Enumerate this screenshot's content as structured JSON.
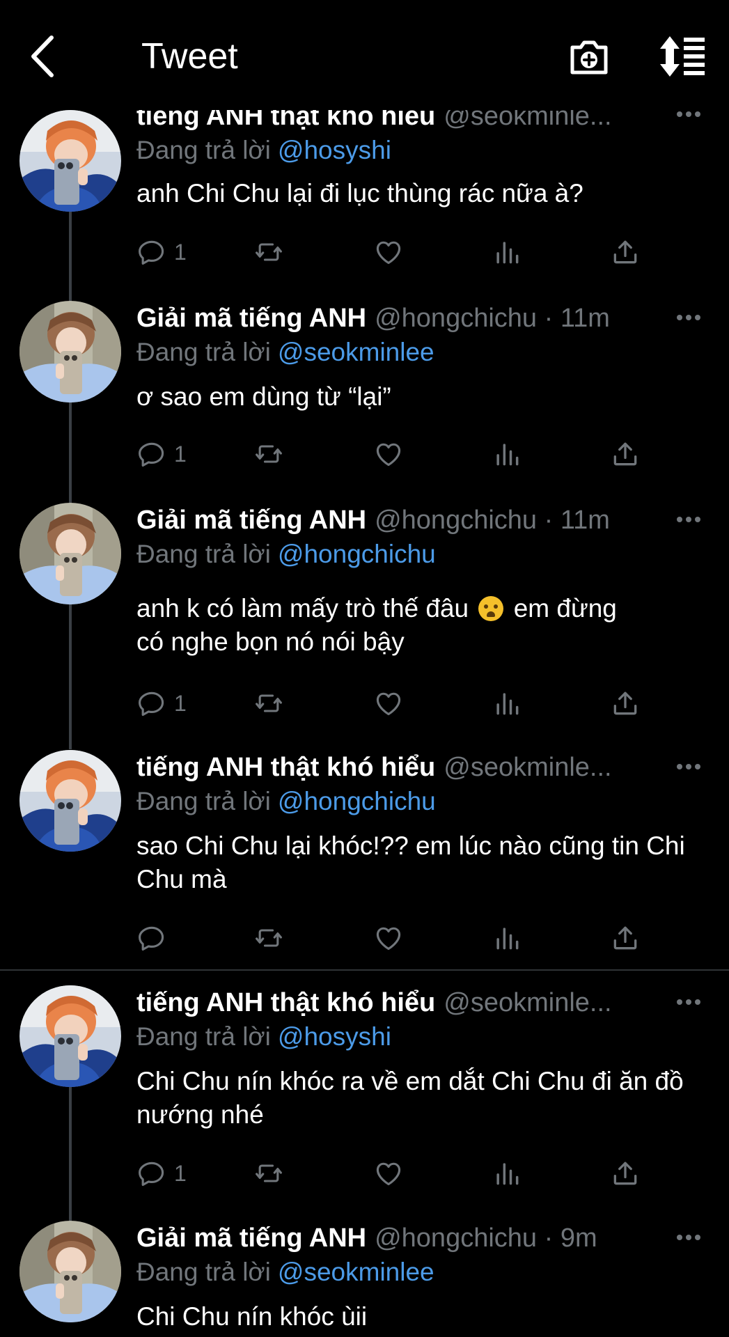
{
  "header": {
    "title": "Tweet"
  },
  "tweets": [
    {
      "name": "tiếng ANH thật khó hiểu",
      "handle": "@seokminle...",
      "reply_prefix": "Đang trả lời",
      "reply_to": "@hosyshi",
      "text": "anh Chi Chu lại đi lục thùng rác nữa à?",
      "replies": "1"
    },
    {
      "name": "Giải mã tiếng ANH",
      "handle": "@hongchichu · 11m",
      "reply_prefix": "Đang trả lời",
      "reply_to": "@seokminlee",
      "text": "ơ sao em dùng từ “lại”",
      "replies": "1"
    },
    {
      "name": "Giải mã tiếng ANH",
      "handle": "@hongchichu · 11m",
      "reply_prefix": "Đang trả lời",
      "reply_to": "@hongchichu",
      "text_a": "anh k có làm mấy trò thế đâu",
      "emoji": "loudly-crying-face",
      "text_b": " em đừng",
      "text_c": "có nghe bọn nó nói bậy",
      "replies": "1"
    },
    {
      "name": "tiếng ANH thật khó hiểu",
      "handle": "@seokminle...",
      "reply_prefix": "Đang trả lời",
      "reply_to": "@hongchichu",
      "text": "sao Chi Chu lại khóc!?? em lúc nào cũng tin Chi Chu mà",
      "replies": ""
    },
    {
      "name": "tiếng ANH thật khó hiểu",
      "handle": "@seokminle...",
      "reply_prefix": "Đang trả lời",
      "reply_to": "@hosyshi",
      "text": "Chi Chu nín khóc ra về em dắt Chi Chu đi ăn đồ nướng nhé",
      "replies": "1"
    },
    {
      "name": "Giải mã tiếng ANH",
      "handle": "@hongchichu · 9m",
      "reply_prefix": "Đang trả lời",
      "reply_to": "@seokminlee",
      "text": "Chi Chu nín khóc ùii"
    }
  ],
  "icons": {
    "back": "chevron-left-icon",
    "camera": "camera-plus-icon",
    "sort": "sort-icon",
    "reply": "comment-icon",
    "retweet": "retweet-icon",
    "like": "heart-icon",
    "views": "analytics-icon",
    "share": "share-icon",
    "more": "more-icon"
  },
  "colors": {
    "background": "#000000",
    "mention": "#4c9be8",
    "muted": "#71767b",
    "text": "#ffffff"
  }
}
